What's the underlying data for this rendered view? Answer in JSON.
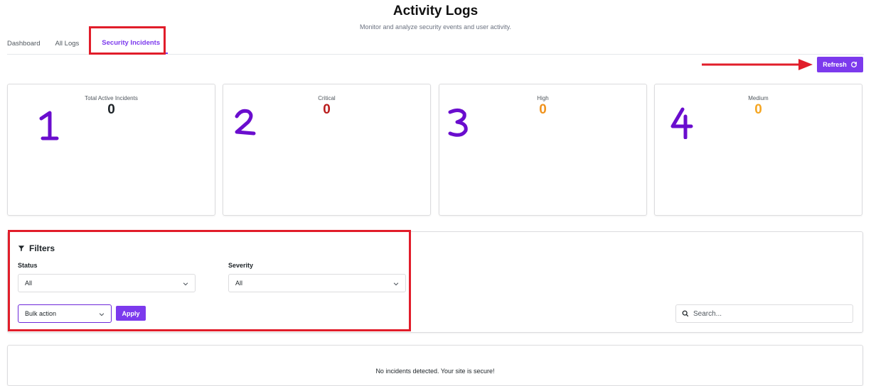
{
  "header": {
    "title": "Activity Logs",
    "subtitle": "Monitor and analyze security events and user activity."
  },
  "tabs": [
    {
      "label": "Dashboard",
      "active": false
    },
    {
      "label": "All Logs",
      "active": false
    },
    {
      "label": "Security Incidents",
      "active": true
    }
  ],
  "toolbar": {
    "refresh_label": "Refresh",
    "refresh_icon": "refresh-icon"
  },
  "stats": [
    {
      "label": "Total Active Incidents",
      "value": "0",
      "color": "#1d2327"
    },
    {
      "label": "Critical",
      "value": "0",
      "color": "#b91c1c"
    },
    {
      "label": "High",
      "value": "0",
      "color": "#f0931e"
    },
    {
      "label": "Medium",
      "value": "0",
      "color": "#f5a623"
    }
  ],
  "filters": {
    "title": "Filters",
    "title_icon": "filter-icon",
    "status": {
      "label": "Status",
      "value": "All"
    },
    "severity": {
      "label": "Severity",
      "value": "All"
    },
    "bulk_action": {
      "value": "Bulk action"
    },
    "apply_label": "Apply",
    "search": {
      "placeholder": "Search...",
      "value": ""
    }
  },
  "empty_state": {
    "message": "No incidents detected. Your site is secure!"
  },
  "annotations": {
    "highlight_color": "#e11d2a",
    "number_color": "#6a0dce",
    "numbers": [
      "1",
      "2",
      "3",
      "4"
    ]
  },
  "colors": {
    "accent": "#7c3aed"
  }
}
